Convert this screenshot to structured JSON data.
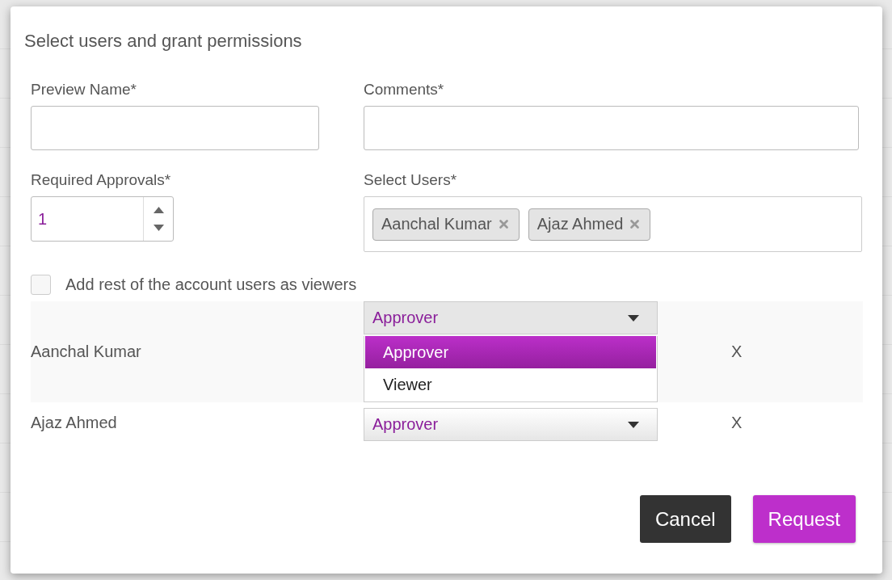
{
  "dialog": {
    "title": "Select users and grant permissions"
  },
  "preview_name": {
    "label": "Preview Name*"
  },
  "comments": {
    "label": "Comments*"
  },
  "required_approvals": {
    "label": "Required Approvals*",
    "value": "1"
  },
  "select_users": {
    "label": "Select Users*",
    "chips": [
      {
        "label": "Aanchal Kumar"
      },
      {
        "label": "Ajaz Ahmed"
      }
    ]
  },
  "viewers_option": {
    "label": "Add rest of the account users as viewers",
    "checked": false
  },
  "users": [
    {
      "name": "Aanchal Kumar",
      "role": "Approver",
      "expanded": true,
      "options": [
        {
          "label": "Approver",
          "selected": true
        },
        {
          "label": "Viewer",
          "selected": false
        }
      ],
      "remove": "X"
    },
    {
      "name": "Ajaz Ahmed",
      "role": "Approver",
      "expanded": false,
      "remove": "X"
    }
  ],
  "buttons": [
    {
      "label": "Cancel",
      "kind": "secondary"
    },
    {
      "label": "Request",
      "kind": "primary"
    }
  ]
}
